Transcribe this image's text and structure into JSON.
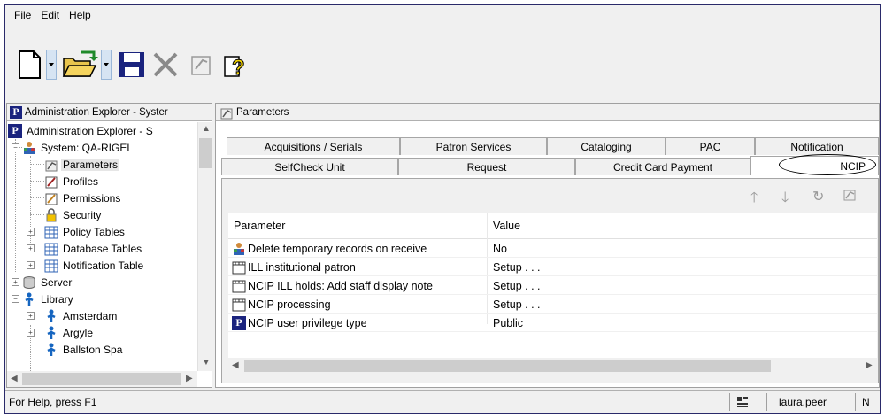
{
  "menubar": {
    "items": [
      "File",
      "Edit",
      "Help"
    ]
  },
  "toolbar": {
    "icons": [
      "new-document-icon",
      "open-folder-icon",
      "save-icon",
      "delete-icon",
      "properties-icon",
      "help-icon"
    ]
  },
  "left_pane": {
    "title": "Administration Explorer - Syster",
    "tree": [
      {
        "label": "Administration Explorer - S",
        "icon": "polaris-icon"
      },
      {
        "label": "System: QA-RIGEL",
        "icon": "system-users-icon"
      },
      {
        "label": "Parameters",
        "icon": "parameters-icon",
        "selected": true
      },
      {
        "label": "Profiles",
        "icon": "profiles-icon"
      },
      {
        "label": "Permissions",
        "icon": "permissions-icon"
      },
      {
        "label": "Security",
        "icon": "lock-icon"
      },
      {
        "label": "Policy Tables",
        "icon": "table-icon"
      },
      {
        "label": "Database Tables",
        "icon": "table-icon"
      },
      {
        "label": "Notification Table",
        "icon": "table-icon"
      },
      {
        "label": "Server",
        "icon": "server-icon"
      },
      {
        "label": "Library",
        "icon": "library-icon"
      },
      {
        "label": "Amsterdam",
        "icon": "library-icon"
      },
      {
        "label": "Argyle",
        "icon": "library-icon"
      },
      {
        "label": "Ballston Spa",
        "icon": "library-icon"
      }
    ]
  },
  "right_pane": {
    "title": "Parameters",
    "tabs_row1": [
      "Acquisitions / Serials",
      "Patron Services",
      "Cataloging",
      "PAC",
      "Notification"
    ],
    "tabs_row2": [
      "SelfCheck Unit",
      "Request",
      "Credit Card Payment",
      "NCIP"
    ],
    "active_tab": "NCIP",
    "toolbar_icons": [
      "arrow-up-icon",
      "arrow-down-icon",
      "refresh-icon",
      "properties-icon"
    ],
    "grid": {
      "columns": [
        "Parameter",
        "Value"
      ],
      "rows": [
        {
          "parameter": "Delete temporary records on receive",
          "value": "No",
          "icon": "system-users-icon"
        },
        {
          "parameter": "ILL institutional patron",
          "value": "Setup . . .",
          "icon": "table-icon"
        },
        {
          "parameter": "NCIP ILL holds: Add staff display note",
          "value": "Setup . . .",
          "icon": "table-icon"
        },
        {
          "parameter": "NCIP processing",
          "value": "Setup . . .",
          "icon": "table-icon"
        },
        {
          "parameter": "NCIP user privilege type",
          "value": "Public",
          "icon": "polaris-icon"
        }
      ]
    }
  },
  "statusbar": {
    "help_text": "For Help, press F1",
    "user": "laura.peer",
    "extra": "N"
  },
  "logo_letter": "P",
  "colors": {
    "frame": "#2a2a6a",
    "polaris_blue": "#1a237e",
    "chrome": "#f0f0f0"
  }
}
